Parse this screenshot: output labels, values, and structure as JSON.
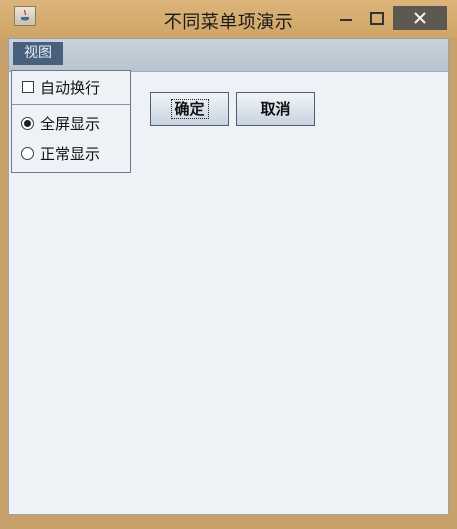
{
  "window": {
    "title": "不同菜单项演示"
  },
  "menubar": {
    "view_label": "视图"
  },
  "popup_menu": {
    "items": [
      {
        "label": "自动换行",
        "type": "checkbox",
        "checked": false
      },
      {
        "label": "全屏显示",
        "type": "radio",
        "checked": true
      },
      {
        "label": "正常显示",
        "type": "radio",
        "checked": false
      }
    ]
  },
  "buttons": {
    "ok_label": "确定",
    "cancel_label": "取消"
  }
}
